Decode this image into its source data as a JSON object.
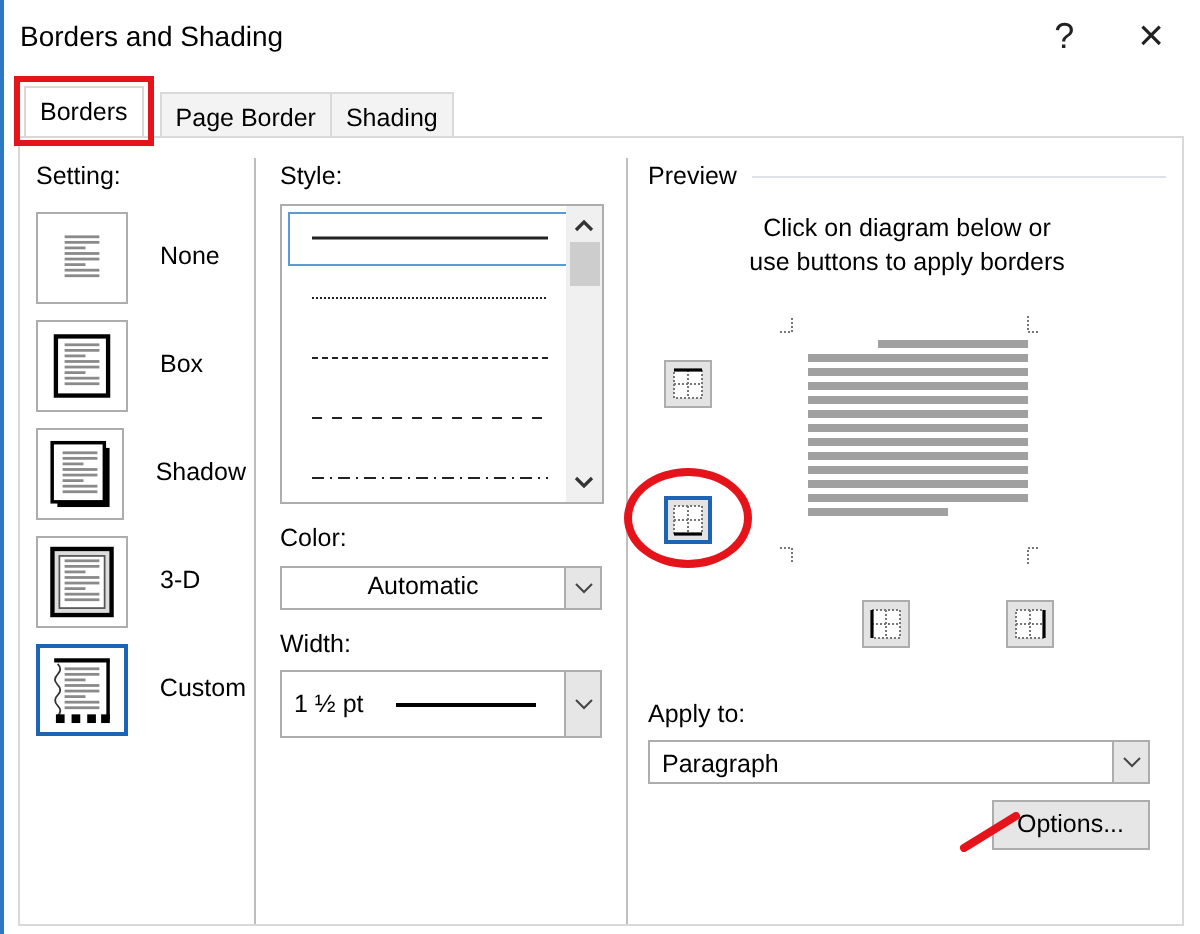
{
  "window": {
    "title": "Borders and Shading",
    "buttons": [
      {
        "kind": "help",
        "label": "?"
      },
      {
        "kind": "close",
        "label": "×"
      }
    ]
  },
  "tabs": [
    {
      "label": "Borders",
      "selected": true,
      "highlighted": true
    },
    {
      "label": "Page Border",
      "selected": false,
      "highlighted": false
    },
    {
      "label": "Shading",
      "selected": false,
      "highlighted": false
    }
  ],
  "setting": {
    "label": "Setting:",
    "options": [
      {
        "label": "None",
        "kind": "none",
        "selected": false
      },
      {
        "label": "Box",
        "kind": "box",
        "selected": false
      },
      {
        "label": "Shadow",
        "kind": "shadow",
        "selected": false
      },
      {
        "label": "3-D",
        "kind": "three-d",
        "selected": false
      },
      {
        "label": "Custom",
        "kind": "custom",
        "selected": true
      }
    ]
  },
  "style": {
    "label": "Style:",
    "lines": [
      {
        "kind": "solid",
        "selected": true
      },
      {
        "kind": "dotted",
        "selected": false
      },
      {
        "kind": "dashed",
        "selected": false
      },
      {
        "kind": "long-dashed",
        "selected": false
      },
      {
        "kind": "dash-dot",
        "selected": false
      }
    ]
  },
  "color": {
    "label": "Color:",
    "value": "Automatic"
  },
  "width": {
    "label": "Width:",
    "value": "1 ½ pt"
  },
  "preview": {
    "label": "Preview",
    "hint": "Click on diagram below or\nuse buttons to apply borders",
    "border_buttons": [
      {
        "kind": "top",
        "selected": false,
        "highlighted": false
      },
      {
        "kind": "bottom",
        "selected": true,
        "highlighted": true
      },
      {
        "kind": "left",
        "selected": false,
        "highlighted": false
      },
      {
        "kind": "right",
        "selected": false,
        "highlighted": false
      }
    ]
  },
  "apply_to": {
    "label": "Apply to:",
    "value": "Paragraph"
  },
  "options_button": {
    "label": "Options...",
    "highlighted": true
  }
}
